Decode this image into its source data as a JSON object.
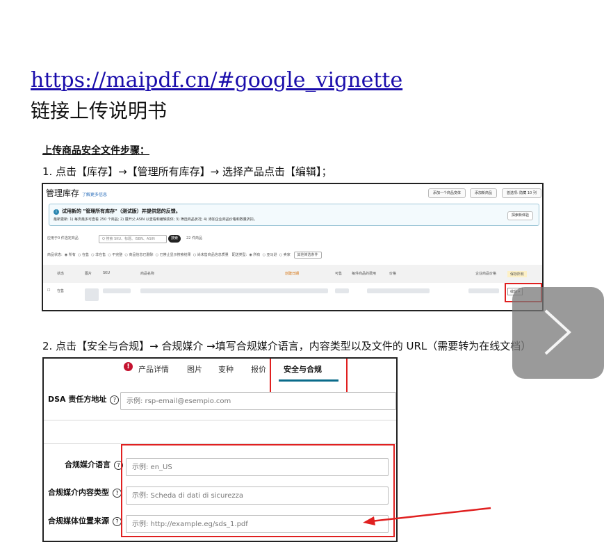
{
  "header": {
    "url": "https://maipdf.cn/#google_vignette",
    "subtitle": "链接上传说明书"
  },
  "section_title": "上传商品安全文件步骤：",
  "steps": {
    "step1": "1.   点击【库存】→【管理所有库存】→ 选择产品点击【编辑】；",
    "step2": "2.   点击【安全与合规】→ 合规媒介 →填写合规媒介语言，内容类型以及文件的 URL（需要转为在线文档）"
  },
  "inventory": {
    "title": "管理库存",
    "learn_more": "了解更多信息",
    "buttons": [
      "添加一个商品变体",
      "添加新商品",
      "首选项: 隐藏 10 列"
    ],
    "banner_title": "试用新的 \"管理所有库存\"（测试版）并提供您的反馈。",
    "banner_text": "最新更新: 1) 每页最多可查看 250 个商品; 2) 展开父 ASIN 以查看和编辑变体; 3) 筛选商品状况; 4) 添加企业商品价格和数量折扣。",
    "banner_button": "探索新体验",
    "selected": "应用于0 件选定商品",
    "search_placeholder": "Q 搜索 SKU、标题、ISBN、ASIN",
    "search_button": "搜索",
    "count": "22 件商品",
    "filter_label": "商品状态:",
    "filters": [
      "所有",
      "在售",
      "非在售",
      "不完整",
      "商品信息已删除",
      "已禁止显示搜索结果",
      "尚未售商品信息质量"
    ],
    "fulfillment_label": "配送类型:",
    "fulfillment_filters": [
      "所有",
      "亚马逊",
      "卖家"
    ],
    "more_filters": "其他筛选条件",
    "columns": [
      "状态",
      "图片",
      "SKU",
      "商品名称",
      "创建日期",
      "可售",
      "每件商品的费用",
      "价格",
      "企业商品价格",
      "保存所有"
    ],
    "row_status": "在售",
    "edit_button": "编辑"
  },
  "compliance": {
    "tabs": [
      "产品详情",
      "图片",
      "变种",
      "报价",
      "安全与合规"
    ],
    "active_tab": "安全与合规",
    "dsa_label": "DSA 责任方地址",
    "dsa_placeholder": "示例:  rsp-email@esempio.com",
    "fields": [
      {
        "label": "合规媒介语言",
        "placeholder": "示例:   en_US"
      },
      {
        "label": "合规媒介内容类型",
        "placeholder": "示例:   Scheda di dati di sicurezza"
      },
      {
        "label": "合规媒体位置来源",
        "placeholder": "示例:   http://example.eg/sds_1.pdf"
      }
    ]
  },
  "accent_red": "#e02020",
  "link_color": "#1a0dab",
  "icons": [
    "info-icon",
    "error-icon",
    "help-icon",
    "chevron-right-icon",
    "red-arrow-icon"
  ]
}
